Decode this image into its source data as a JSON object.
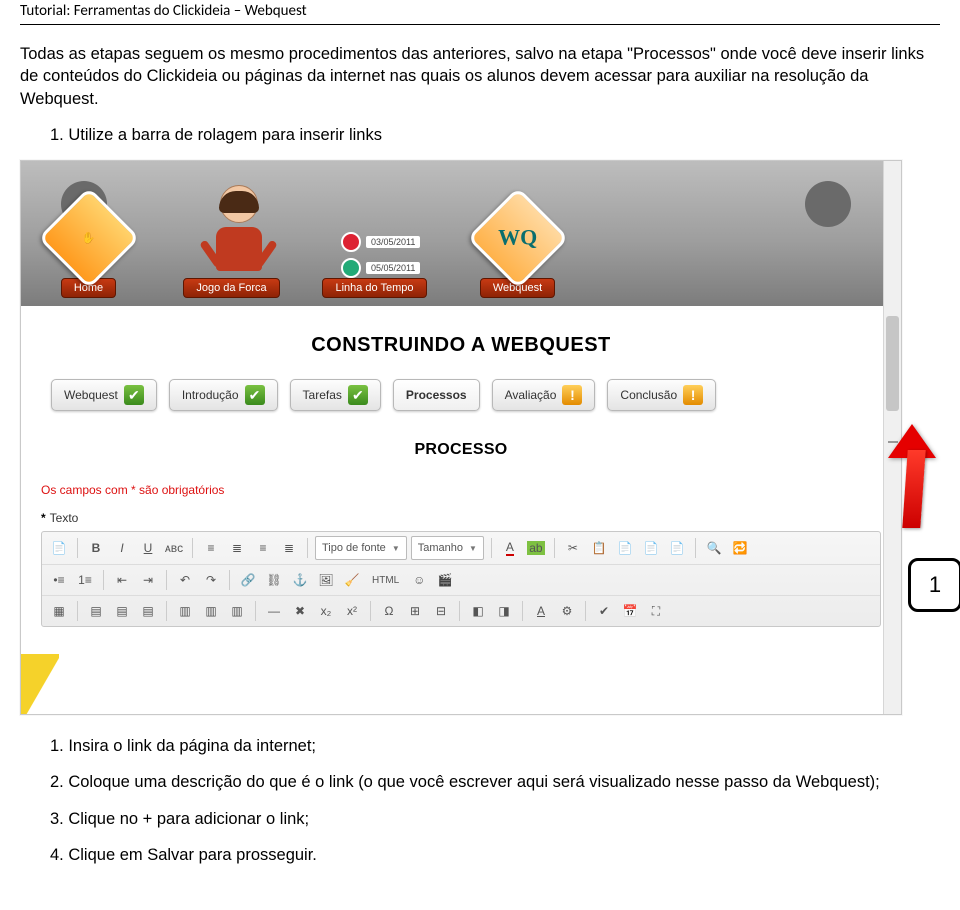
{
  "header": "Tutorial: Ferramentas do Clickideia – Webquest",
  "intro": "Todas as etapas seguem os mesmo procedimentos das anteriores, salvo na etapa \"Processos\" onde você deve inserir links de conteúdos do Clickideia ou páginas da internet nas quais os alunos devem acessar para auxiliar na resolução da Webquest.",
  "step1": "1.  Utilize a barra de rolagem para inserir links",
  "callout_num": "1",
  "nav": {
    "home": "Home",
    "jogo": "Jogo da Forca",
    "linha": "Linha do Tempo",
    "webquest": "Webquest",
    "date1": "03/05/2011",
    "date2": "05/05/2011",
    "wq_logo": "WQ"
  },
  "builder": {
    "title": "CONSTRUINDO A WEBQUEST",
    "tabs": {
      "webquest": "Webquest",
      "introducao": "Introdução",
      "tarefas": "Tarefas",
      "processos": "Processos",
      "avaliacao": "Avaliação",
      "conclusao": "Conclusão"
    },
    "section": "PROCESSO",
    "required_note": "Os campos com * são obrigatórios",
    "field_label": "Texto",
    "font_family": "Tipo de fonte",
    "font_size": "Tamanho",
    "html_btn": "HTML"
  },
  "footer": {
    "l1": "1.   Insira o link da página da internet;",
    "l2": "2.   Coloque uma descrição do que é o link (o que você escrever aqui será visualizado nesse passo da Webquest);",
    "l3": "3.   Clique no + para adicionar o link;",
    "l4": "4.   Clique em Salvar para prosseguir."
  }
}
